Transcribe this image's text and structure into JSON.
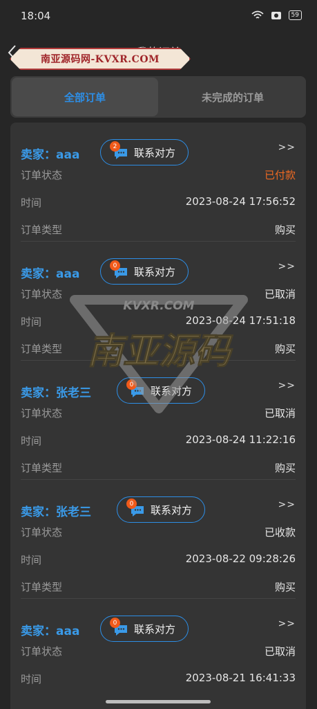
{
  "status_bar": {
    "time": "18:04",
    "battery": "59"
  },
  "nav": {
    "title": "我的订单",
    "banner_text": "南亚源码网-KVXR.COM"
  },
  "tabs": [
    {
      "label": "全部订单",
      "active": true
    },
    {
      "label": "未完成的订单",
      "active": false
    }
  ],
  "labels": {
    "status": "订单状态",
    "time": "时间",
    "type": "订单类型",
    "contact": "联系对方",
    "more": ">>"
  },
  "orders": [
    {
      "seller": "卖家：aaa",
      "unread": "2",
      "status": "已付款",
      "time": "2023-08-24 17:56:52",
      "type": "购买"
    },
    {
      "seller": "卖家：aaa",
      "unread": "0",
      "status": "已取消",
      "time": "2023-08-24 17:51:18",
      "type": "购买"
    },
    {
      "seller": "卖家：张老三",
      "unread": "0",
      "status": "已取消",
      "time": "2023-08-24 11:22:16",
      "type": "购买"
    },
    {
      "seller": "卖家：张老三",
      "unread": "0",
      "status": "已收款",
      "time": "2023-08-22 09:28:26",
      "type": "购买"
    },
    {
      "seller": "卖家：aaa",
      "unread": "0",
      "status": "已取消",
      "time": "2023-08-21 16:41:33",
      "type": ""
    }
  ],
  "watermark": {
    "top_text": "KVXR.COM",
    "main_text": "南亚源码"
  },
  "colors": {
    "accent": "#2d8ee6",
    "paid": "#ef6a22",
    "badge": "#f05a1a"
  }
}
